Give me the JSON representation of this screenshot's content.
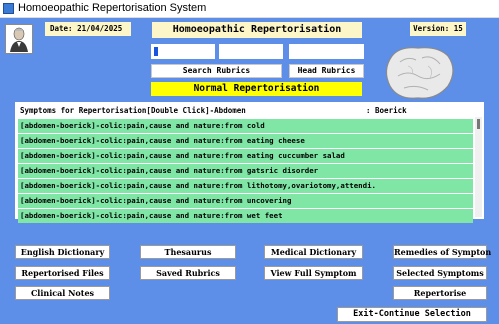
{
  "window": {
    "title": "Homoeopathic Repertorisation System"
  },
  "header": {
    "date": "Date: 21/04/2025",
    "heading": "Homoeopathic Repertorisation",
    "version": "Version: 15"
  },
  "search": {
    "search_rubrics_label": "Search Rubrics",
    "head_rubrics_label": "Head Rubrics"
  },
  "mode": {
    "label": "Normal Repertorisation"
  },
  "symptoms": {
    "header": "Symptoms for Repertorisation[Double Click]-Abdomen",
    "source": ": Boerick",
    "items": [
      "[abdomen-boerick]-colic:pain,cause and nature:from cold",
      "[abdomen-boerick]-colic:pain,cause and nature:from eating cheese",
      "[abdomen-boerick]-colic:pain,cause and nature:from eating cuccumber salad",
      "[abdomen-boerick]-colic:pain,cause and nature:from gatsric disorder",
      "[abdomen-boerick]-colic:pain,cause and nature:from lithotomy,ovariotomy,attendi.",
      "[abdomen-boerick]-colic:pain,cause and nature:from uncovering",
      "[abdomen-boerick]-colic:pain,cause and nature:from wet feet"
    ]
  },
  "buttons": {
    "english_dictionary": "English Dictionary",
    "thesaurus": "Thesaurus",
    "medical_dictionary": "Medical Dictionary",
    "remedies_of_symptom": "Remedies of Sympton",
    "repertorised_files": "Repertorised Files",
    "saved_rubrics": "Saved Rubrics",
    "view_full_symptom": "View Full Symptom",
    "selected_symptoms": "Selected Symptoms",
    "clinical_notes": "Clinical Notes",
    "repertorise": "Repertorise",
    "exit_continue": "Exit-Continue Selection"
  },
  "colors": {
    "background": "#5d8ee8",
    "header_box": "#fdf6c8",
    "banner": "#ffff00",
    "list_row": "#7fe6a6"
  },
  "icons": {
    "portrait": "hahnemann-portrait-icon",
    "organ": "stomach-organ-icon",
    "app": "app-icon"
  }
}
